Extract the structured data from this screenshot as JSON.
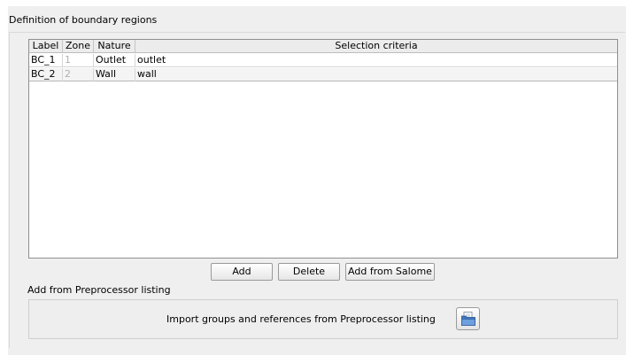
{
  "boundary": {
    "group_title": "Definition of boundary regions",
    "table": {
      "columns": [
        "Label",
        "Zone",
        "Nature",
        "Selection criteria"
      ],
      "rows": [
        {
          "label": "BC_1",
          "zone": "1",
          "nature": "Outlet",
          "selection": "outlet"
        },
        {
          "label": "BC_2",
          "zone": "2",
          "nature": "Wall",
          "selection": "wall"
        }
      ]
    },
    "buttons": {
      "add": "Add",
      "delete": "Delete",
      "add_from_salome": "Add from Salome"
    }
  },
  "preprocessor": {
    "title": "Add from Preprocessor listing",
    "import_label": "Import groups and references from Preprocessor listing",
    "import_icon": "folder-open-icon"
  }
}
